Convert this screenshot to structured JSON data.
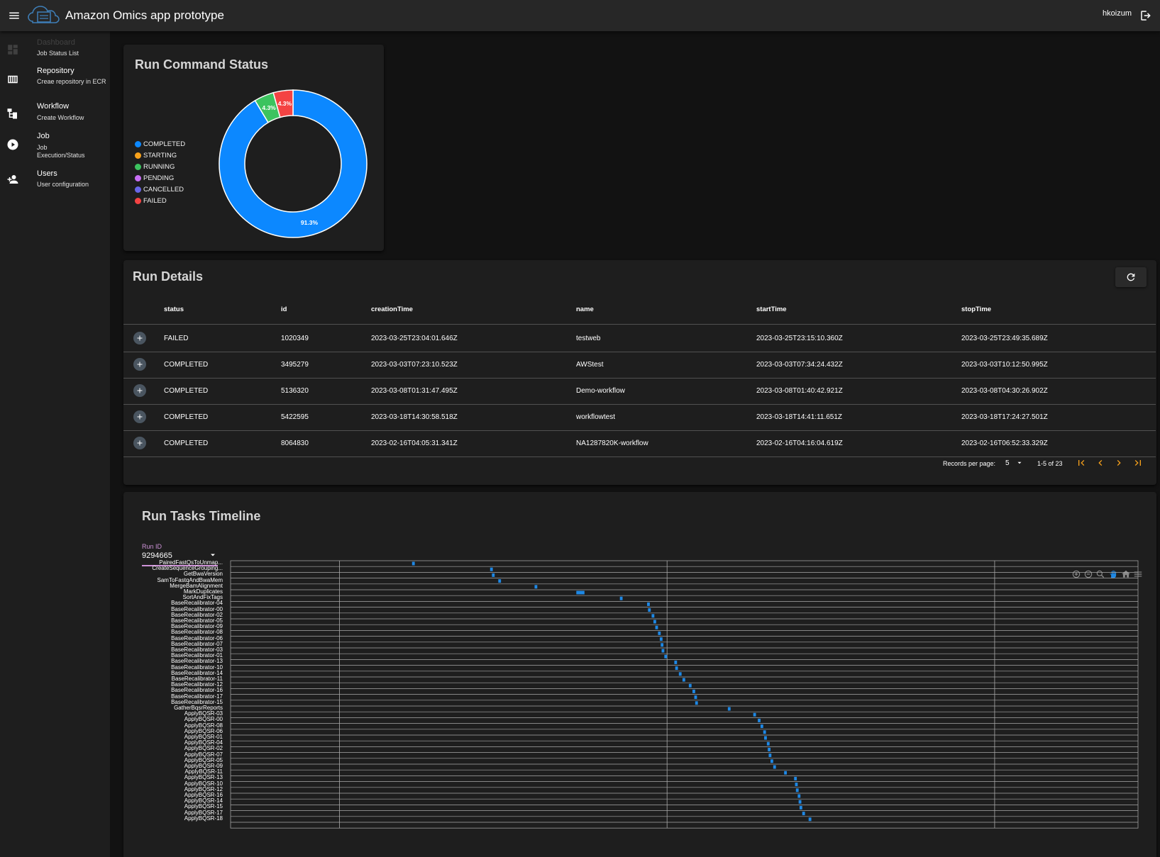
{
  "app": {
    "title": "Amazon Omics app prototype",
    "user": "hkoizum"
  },
  "sidebar": {
    "items": [
      {
        "label": "Dashboard",
        "sub": "Job Status List",
        "icon": "dashboard-icon"
      },
      {
        "label": "Repository",
        "sub": "Creae repository in ECR",
        "icon": "repository-icon"
      },
      {
        "label": "Workflow",
        "sub": "Create Workflow",
        "icon": "workflow-icon"
      },
      {
        "label": "Job",
        "sub": "Job Execution/Status",
        "icon": "play-circle-icon"
      },
      {
        "label": "Users",
        "sub": "User configuration",
        "icon": "person-add-icon"
      }
    ]
  },
  "run_status": {
    "title": "Run Command Status",
    "legend": [
      {
        "label": "COMPLETED",
        "color": "#0c88ff"
      },
      {
        "label": "STARTING",
        "color": "#f7a11b"
      },
      {
        "label": "RUNNING",
        "color": "#3cc35f"
      },
      {
        "label": "PENDING",
        "color": "#c86ef5"
      },
      {
        "label": "CANCELLED",
        "color": "#6866e8"
      },
      {
        "label": "FAILED",
        "color": "#f44343"
      }
    ],
    "slice_labels": {
      "completed": "91.3%",
      "running": "4.3%",
      "failed": "4.3%"
    }
  },
  "chart_data": {
    "type": "pie",
    "categories": [
      "COMPLETED",
      "STARTING",
      "RUNNING",
      "PENDING",
      "CANCELLED",
      "FAILED"
    ],
    "values": [
      91.3,
      0,
      4.3,
      0,
      0,
      4.3
    ],
    "title": "Run Command Status",
    "legend": "left"
  },
  "run_details": {
    "title": "Run Details",
    "columns": [
      "status",
      "id",
      "creationTime",
      "name",
      "startTime",
      "stopTime"
    ],
    "rows": [
      [
        "FAILED",
        "1020349",
        "2023-03-25T23:04:01.646Z",
        "testweb",
        "2023-03-25T23:15:10.360Z",
        "2023-03-25T23:49:35.689Z"
      ],
      [
        "COMPLETED",
        "3495279",
        "2023-03-03T07:23:10.523Z",
        "AWStest",
        "2023-03-03T07:34:24.432Z",
        "2023-03-03T10:12:50.995Z"
      ],
      [
        "COMPLETED",
        "5136320",
        "2023-03-08T01:31:47.495Z",
        "Demo-workflow",
        "2023-03-08T01:40:42.921Z",
        "2023-03-08T04:30:26.902Z"
      ],
      [
        "COMPLETED",
        "5422595",
        "2023-03-18T14:30:58.518Z",
        "workflowtest",
        "2023-03-18T14:41:11.651Z",
        "2023-03-18T17:24:27.501Z"
      ],
      [
        "COMPLETED",
        "8064830",
        "2023-02-16T04:05:31.341Z",
        "NA1287820K-workflow",
        "2023-02-16T04:16:04.619Z",
        "2023-02-16T06:52:33.329Z"
      ]
    ],
    "records_per_page_label": "Records per page:",
    "records_per_page": "5",
    "page_range": "1-5 of 23"
  },
  "timeline": {
    "title": "Run Tasks Timeline",
    "run_id_label": "Run ID",
    "run_id": "9294665",
    "bar_color": "#1e88e5",
    "tasks": [
      {
        "name": "PairedFastQsToUnmap...",
        "start": 0.2,
        "end": 0.203
      },
      {
        "name": "CreateSequenceGrouping...",
        "start": 0.286,
        "end": 0.289
      },
      {
        "name": "GetBwaVersion",
        "start": 0.288,
        "end": 0.291
      },
      {
        "name": "SamToFastqAndBwaMem",
        "start": 0.295,
        "end": 0.298
      },
      {
        "name": "MergeBamAlignment",
        "start": 0.335,
        "end": 0.338
      },
      {
        "name": "MarkDuplicates",
        "start": 0.381,
        "end": 0.39
      },
      {
        "name": "SortAndFixTags",
        "start": 0.429,
        "end": 0.432
      },
      {
        "name": "BaseRecalibrator-04",
        "start": 0.459,
        "end": 0.462
      },
      {
        "name": "BaseRecalibrator-00",
        "start": 0.46,
        "end": 0.463
      },
      {
        "name": "BaseRecalibrator-02",
        "start": 0.464,
        "end": 0.467
      },
      {
        "name": "BaseRecalibrator-05",
        "start": 0.466,
        "end": 0.469
      },
      {
        "name": "BaseRecalibrator-09",
        "start": 0.468,
        "end": 0.471
      },
      {
        "name": "BaseRecalibrator-08",
        "start": 0.471,
        "end": 0.474
      },
      {
        "name": "BaseRecalibrator-06",
        "start": 0.473,
        "end": 0.476
      },
      {
        "name": "BaseRecalibrator-07",
        "start": 0.474,
        "end": 0.477
      },
      {
        "name": "BaseRecalibrator-03",
        "start": 0.475,
        "end": 0.478
      },
      {
        "name": "BaseRecalibrator-01",
        "start": 0.478,
        "end": 0.481
      },
      {
        "name": "BaseRecalibrator-13",
        "start": 0.489,
        "end": 0.492
      },
      {
        "name": "BaseRecalibrator-10",
        "start": 0.49,
        "end": 0.493
      },
      {
        "name": "BaseRecalibrator-14",
        "start": 0.494,
        "end": 0.497
      },
      {
        "name": "BaseRecalibrator-11",
        "start": 0.498,
        "end": 0.501
      },
      {
        "name": "BaseRecalibrator-12",
        "start": 0.505,
        "end": 0.508
      },
      {
        "name": "BaseRecalibrator-16",
        "start": 0.509,
        "end": 0.512
      },
      {
        "name": "BaseRecalibrator-17",
        "start": 0.511,
        "end": 0.514
      },
      {
        "name": "BaseRecalibrator-15",
        "start": 0.512,
        "end": 0.515
      },
      {
        "name": "GatherBqsrReports",
        "start": 0.548,
        "end": 0.551
      },
      {
        "name": "ApplyBQSR-03",
        "start": 0.576,
        "end": 0.579
      },
      {
        "name": "ApplyBQSR-00",
        "start": 0.581,
        "end": 0.584
      },
      {
        "name": "ApplyBQSR-08",
        "start": 0.584,
        "end": 0.587
      },
      {
        "name": "ApplyBQSR-06",
        "start": 0.587,
        "end": 0.59
      },
      {
        "name": "ApplyBQSR-01",
        "start": 0.588,
        "end": 0.591
      },
      {
        "name": "ApplyBQSR-04",
        "start": 0.591,
        "end": 0.594
      },
      {
        "name": "ApplyBQSR-02",
        "start": 0.592,
        "end": 0.595
      },
      {
        "name": "ApplyBQSR-07",
        "start": 0.593,
        "end": 0.596
      },
      {
        "name": "ApplyBQSR-05",
        "start": 0.595,
        "end": 0.598
      },
      {
        "name": "ApplyBQSR-09",
        "start": 0.598,
        "end": 0.601
      },
      {
        "name": "ApplyBQSR-11",
        "start": 0.61,
        "end": 0.613
      },
      {
        "name": "ApplyBQSR-13",
        "start": 0.621,
        "end": 0.624
      },
      {
        "name": "ApplyBQSR-10",
        "start": 0.622,
        "end": 0.625
      },
      {
        "name": "ApplyBQSR-12",
        "start": 0.623,
        "end": 0.626
      },
      {
        "name": "ApplyBQSR-16",
        "start": 0.625,
        "end": 0.628
      },
      {
        "name": "ApplyBQSR-14",
        "start": 0.626,
        "end": 0.629
      },
      {
        "name": "ApplyBQSR-15",
        "start": 0.627,
        "end": 0.63
      },
      {
        "name": "ApplyBQSR-17",
        "start": 0.63,
        "end": 0.633
      },
      {
        "name": "ApplyBQSR-18",
        "start": 0.637,
        "end": 0.64
      }
    ]
  }
}
